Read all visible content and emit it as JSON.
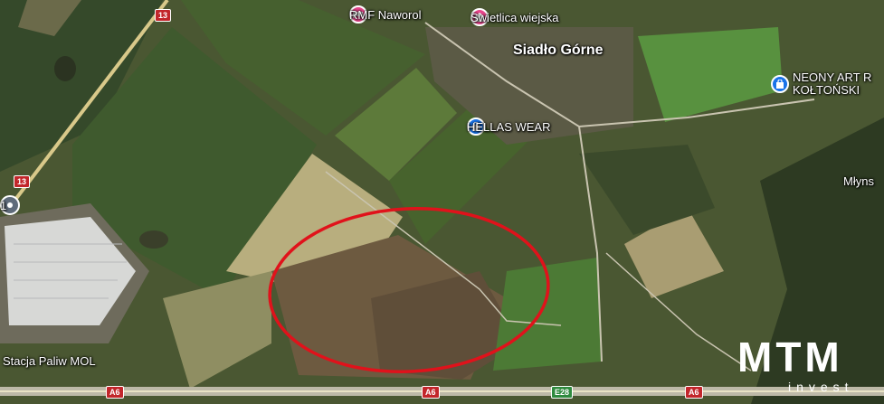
{
  "map": {
    "places": {
      "rmf": "RMF Naworol",
      "swietlica": "Swietlica wiejska",
      "siadlo": "Siadło Górne",
      "neony_line1": "NEONY ART R",
      "neony_line2": "KOŁTOŃSKI",
      "hellas": "HELLAS WEAR",
      "mlyn": "Młyns",
      "stacja": "Stacja Paliw MOL",
      "edge1": "1"
    },
    "roads": {
      "r13_top": "13",
      "r13_left": "13",
      "a6_left": "A6",
      "a6_mid": "A6",
      "a6_right": "A6",
      "e28": "E28"
    },
    "logo": {
      "mark": "MTM",
      "sub": "invest"
    },
    "colors": {
      "highlight_ring": "#e0121b",
      "poi_pink": "#e8468c",
      "poi_blue": "#1a73e8"
    }
  }
}
